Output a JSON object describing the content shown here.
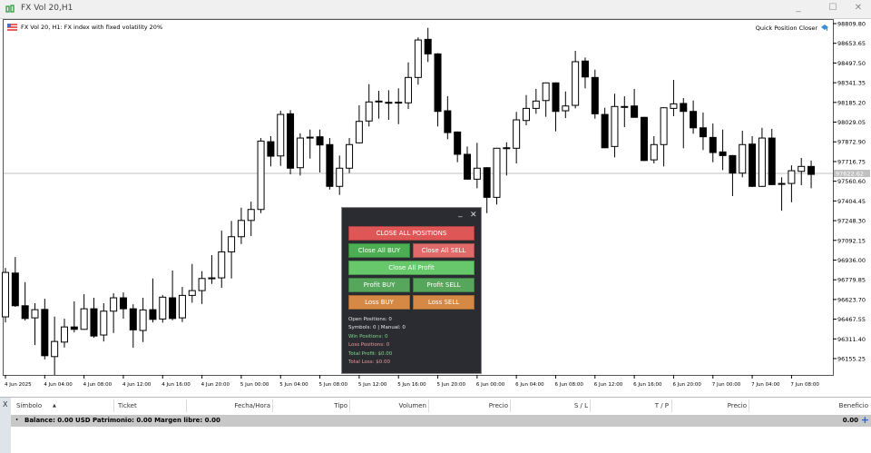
{
  "window": {
    "title": "FX Vol 20,H1"
  },
  "chart": {
    "header": "FX Vol 20, H1:  FX index with fixed volatility 20%",
    "indicator_name": "Quick Position Closer",
    "current_price_label": "97622.62",
    "current_price": 97622.62
  },
  "chart_data": {
    "type": "candlestick",
    "title": "FX Vol 20, H1",
    "ylim": [
      96155.25,
      98809.8
    ],
    "y_ticks": [
      "98809.80",
      "98653.65",
      "98497.50",
      "98341.35",
      "98185.20",
      "98029.05",
      "97872.90",
      "97716.75",
      "97560.60",
      "97404.45",
      "97248.30",
      "97092.15",
      "96936.00",
      "96779.85",
      "96623.70",
      "96467.55",
      "96311.40",
      "96155.25"
    ],
    "x_ticks": [
      "4 Jun 2025",
      "4 Jun 04:00",
      "4 Jun 08:00",
      "4 Jun 12:00",
      "4 Jun 16:00",
      "4 Jun 20:00",
      "5 Jun 00:00",
      "5 Jun 04:00",
      "5 Jun 08:00",
      "5 Jun 12:00",
      "5 Jun 16:00",
      "5 Jun 20:00",
      "6 Jun 00:00",
      "6 Jun 04:00",
      "6 Jun 08:00",
      "6 Jun 12:00",
      "6 Jun 16:00",
      "6 Jun 20:00",
      "7 Jun 00:00",
      "7 Jun 04:00",
      "7 Jun 08:00"
    ],
    "ohlc": [
      [
        96486,
        96874,
        96442,
        96838
      ],
      [
        96833,
        96960,
        96565,
        96574
      ],
      [
        96574,
        96761,
        96457,
        96473
      ],
      [
        96478,
        96594,
        96262,
        96543
      ],
      [
        96545,
        96629,
        96149,
        96178
      ],
      [
        96171,
        96488,
        96025,
        96291
      ],
      [
        96286,
        96471,
        96243,
        96406
      ],
      [
        96406,
        96608,
        96363,
        96387
      ],
      [
        96387,
        96665,
        96385,
        96550
      ],
      [
        96550,
        96637,
        96320,
        96334
      ],
      [
        96342,
        96594,
        96291,
        96531
      ],
      [
        96531,
        96673,
        96358,
        96637
      ],
      [
        96637,
        96680,
        96471,
        96550
      ],
      [
        96550,
        96586,
        96241,
        96383
      ],
      [
        96378,
        96637,
        96286,
        96541
      ],
      [
        96543,
        96790,
        96442,
        96466
      ],
      [
        96469,
        96658,
        96440,
        96642
      ],
      [
        96637,
        96853,
        96459,
        96473
      ],
      [
        96478,
        96723,
        96445,
        96656
      ],
      [
        96656,
        96905,
        96598,
        96694
      ],
      [
        96694,
        96848,
        96588,
        96790
      ],
      [
        96788,
        96975,
        96747,
        96795
      ],
      [
        96795,
        97169,
        96716,
        97001
      ],
      [
        97001,
        97246,
        96790,
        97121
      ],
      [
        97121,
        97351,
        97063,
        97250
      ],
      [
        97250,
        97399,
        97126,
        97337
      ],
      [
        97337,
        97903,
        97308,
        97879
      ],
      [
        97874,
        97918,
        97678,
        97759
      ],
      [
        97761,
        98119,
        97682,
        98090
      ],
      [
        98095,
        98124,
        97615,
        97664
      ],
      [
        97668,
        97941,
        97606,
        97903
      ],
      [
        97910,
        97970,
        97740,
        97907
      ],
      [
        97913,
        97970,
        97630,
        97848
      ],
      [
        97851,
        97903,
        97495,
        97520
      ],
      [
        97520,
        97764,
        97452,
        97664
      ],
      [
        97664,
        97903,
        97625,
        97851
      ],
      [
        97865,
        98162,
        97860,
        98035
      ],
      [
        98038,
        98330,
        97995,
        98189
      ],
      [
        98196,
        98277,
        98056,
        98193
      ],
      [
        98186,
        98282,
        98047,
        98184
      ],
      [
        98184,
        98297,
        98013,
        98187
      ],
      [
        98182,
        98503,
        98133,
        98383
      ],
      [
        98383,
        98700,
        98326,
        98680
      ],
      [
        98685,
        98776,
        98505,
        98570
      ],
      [
        98570,
        98575,
        97995,
        98114
      ],
      [
        98119,
        98234,
        97894,
        97946
      ],
      [
        97951,
        97955,
        97711,
        97774
      ],
      [
        97774,
        97836,
        97572,
        97577
      ],
      [
        97577,
        97865,
        97505,
        97664
      ],
      [
        97668,
        97672,
        97308,
        97433
      ],
      [
        97433,
        97826,
        97376,
        97822
      ],
      [
        97826,
        97869,
        97606,
        97824
      ],
      [
        97822,
        98110,
        97702,
        98047
      ],
      [
        98042,
        98244,
        98004,
        98138
      ],
      [
        98138,
        98292,
        98095,
        98196
      ],
      [
        98200,
        98343,
        98071,
        98340
      ],
      [
        98340,
        98344,
        97956,
        98114
      ],
      [
        98119,
        98272,
        98061,
        98157
      ],
      [
        98162,
        98594,
        98138,
        98508
      ],
      [
        98513,
        98541,
        98297,
        98387
      ],
      [
        98383,
        98445,
        98056,
        98095
      ],
      [
        98090,
        98143,
        97822,
        97826
      ],
      [
        97836,
        98254,
        97750,
        98153
      ],
      [
        98153,
        98234,
        97990,
        98151
      ],
      [
        98157,
        98292,
        98065,
        98067
      ],
      [
        98067,
        98071,
        97721,
        97725
      ],
      [
        97730,
        97918,
        97702,
        97851
      ],
      [
        97851,
        98147,
        97678,
        98143
      ],
      [
        98138,
        98364,
        98076,
        98174
      ],
      [
        98177,
        98220,
        97822,
        98114
      ],
      [
        98114,
        98200,
        97937,
        97984
      ],
      [
        97984,
        98105,
        97808,
        97913
      ],
      [
        97908,
        98018,
        97711,
        97788
      ],
      [
        97793,
        97970,
        97649,
        97764
      ],
      [
        97764,
        97768,
        97443,
        97625
      ],
      [
        97625,
        97961,
        97592,
        97851
      ],
      [
        97855,
        97918,
        97515,
        97520
      ],
      [
        97520,
        97984,
        97515,
        97903
      ],
      [
        97903,
        97975,
        97530,
        97534
      ],
      [
        97543,
        97592,
        97327,
        97541
      ],
      [
        97543,
        97687,
        97394,
        97644
      ],
      [
        97639,
        97745,
        97529,
        97678
      ],
      [
        97678,
        97725,
        97505,
        97615
      ]
    ]
  },
  "panel": {
    "buttons": {
      "close_all": "CLOSE ALL POSITIONS",
      "close_all_buy": "Close All BUY",
      "close_all_sell": "Close All SELL",
      "close_all_profit": "Close All Profit",
      "profit_buy": "Profit BUY",
      "profit_sell": "Profit SELL",
      "loss_buy": "Loss BUY",
      "loss_sell": "Loss SELL"
    },
    "minimize": "_",
    "close": "✕",
    "stats": [
      {
        "text": "Open Positions: 0",
        "color": "#e8e8e8"
      },
      {
        "text": "Symbols: 0 | Manual: 0",
        "color": "#e8e8e8"
      },
      {
        "text": "Win Positions: 0",
        "color": "#7fd88a"
      },
      {
        "text": "Loss Positions: 0",
        "color": "#e89a9a"
      },
      {
        "text": "Total Profit: $0.00",
        "color": "#7fd88a"
      },
      {
        "text": "Total Loss: $0.00",
        "color": "#e89a9a"
      }
    ],
    "colors": {
      "red": "#de5656",
      "pink": "#e06a6a",
      "green": "#4cae52",
      "lightgreen": "#66c76b",
      "midgreen": "#56a65c",
      "orange": "#d68945"
    }
  },
  "toolbox": {
    "close": "X",
    "sort_icon": "▲",
    "columns": [
      "Símbolo",
      "Ticket",
      "Fecha/Hora",
      "Tipo",
      "Volumen",
      "Precio",
      "S / L",
      "T / P",
      "Precio",
      "Beneficio"
    ],
    "balance_text": "Balance: 0.00 USD  Patrimonio: 0.00  Margen libre: 0.00",
    "total": "0.00",
    "add": "+"
  }
}
